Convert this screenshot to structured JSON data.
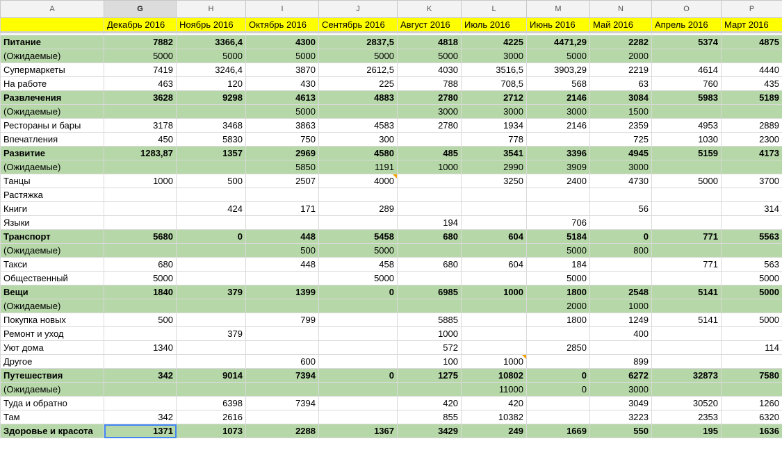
{
  "column_letters": [
    "A",
    "G",
    "H",
    "I",
    "J",
    "K",
    "L",
    "M",
    "N",
    "O",
    "P"
  ],
  "months": [
    "Декабрь 2016",
    "Ноябрь 2016",
    "Октябрь 2016",
    "Сентябрь 2016",
    "Август 2016",
    "Июль 2016",
    "Июнь 2016",
    "Май 2016",
    "Апрель 2016",
    "Март 2016"
  ],
  "colors": {
    "category_fill": "#b6d7a8",
    "header_fill": "#ffff00",
    "selection": "#4285f4",
    "note_marker": "#f4a300"
  },
  "rows": [
    {
      "label": "Питание",
      "type": "category",
      "values": [
        "7882",
        "3366,4",
        "4300",
        "2837,5",
        "4818",
        "4225",
        "4471,29",
        "2282",
        "5374",
        "4875"
      ]
    },
    {
      "label": "(Ожидаемые)",
      "type": "expected",
      "values": [
        "5000",
        "5000",
        "5000",
        "5000",
        "5000",
        "3000",
        "5000",
        "2000",
        "",
        ""
      ]
    },
    {
      "label": "Супермаркеты",
      "type": "item",
      "values": [
        "7419",
        "3246,4",
        "3870",
        "2612,5",
        "4030",
        "3516,5",
        "3903,29",
        "2219",
        "4614",
        "4440"
      ]
    },
    {
      "label": "На работе",
      "type": "item",
      "values": [
        "463",
        "120",
        "430",
        "225",
        "788",
        "708,5",
        "568",
        "63",
        "760",
        "435"
      ]
    },
    {
      "label": "Развлечения",
      "type": "category",
      "values": [
        "3628",
        "9298",
        "4613",
        "4883",
        "2780",
        "2712",
        "2146",
        "3084",
        "5983",
        "5189"
      ]
    },
    {
      "label": "(Ожидаемые)",
      "type": "expected",
      "values": [
        "",
        "",
        "5000",
        "",
        "3000",
        "3000",
        "3000",
        "1500",
        "",
        ""
      ]
    },
    {
      "label": "Рестораны и бары",
      "type": "item",
      "values": [
        "3178",
        "3468",
        "3863",
        "4583",
        "2780",
        "1934",
        "2146",
        "2359",
        "4953",
        "2889"
      ]
    },
    {
      "label": "Впечатления",
      "type": "item",
      "values": [
        "450",
        "5830",
        "750",
        "300",
        "",
        "778",
        "",
        "725",
        "1030",
        "2300"
      ]
    },
    {
      "label": "Развитие",
      "type": "category",
      "values": [
        "1283,87",
        "1357",
        "2969",
        "4580",
        "485",
        "3541",
        "3396",
        "4945",
        "5159",
        "4173"
      ]
    },
    {
      "label": "(Ожидаемые)",
      "type": "expected",
      "values": [
        "",
        "",
        "5850",
        "1191",
        "1000",
        "2990",
        "3909",
        "3000",
        "",
        ""
      ]
    },
    {
      "label": "Танцы",
      "type": "item",
      "values": [
        "1000",
        "500",
        "2507",
        "4000",
        "",
        "3250",
        "2400",
        "4730",
        "5000",
        "3700"
      ]
    },
    {
      "label": "Растяжка",
      "type": "item",
      "values": [
        "",
        "",
        "",
        "",
        "",
        "",
        "",
        "",
        "",
        ""
      ]
    },
    {
      "label": "Книги",
      "type": "item",
      "values": [
        "",
        "424",
        "171",
        "289",
        "",
        "",
        "",
        "56",
        "",
        "314"
      ]
    },
    {
      "label": "Языки",
      "type": "item",
      "values": [
        "",
        "",
        "",
        "",
        "194",
        "",
        "706",
        "",
        "",
        ""
      ]
    },
    {
      "label": "Транспорт",
      "type": "category",
      "values": [
        "5680",
        "0",
        "448",
        "5458",
        "680",
        "604",
        "5184",
        "0",
        "771",
        "5563"
      ]
    },
    {
      "label": "(Ожидаемые)",
      "type": "expected",
      "values": [
        "",
        "",
        "500",
        "5000",
        "",
        "",
        "5000",
        "800",
        "",
        ""
      ]
    },
    {
      "label": "Такси",
      "type": "item",
      "values": [
        "680",
        "",
        "448",
        "458",
        "680",
        "604",
        "184",
        "",
        "771",
        "563"
      ]
    },
    {
      "label": "Общественный",
      "type": "item",
      "values": [
        "5000",
        "",
        "",
        "5000",
        "",
        "",
        "5000",
        "",
        "",
        "5000"
      ]
    },
    {
      "label": "Вещи",
      "type": "category",
      "values": [
        "1840",
        "379",
        "1399",
        "0",
        "6985",
        "1000",
        "1800",
        "2548",
        "5141",
        "5000"
      ]
    },
    {
      "label": "(Ожидаемые)",
      "type": "expected",
      "values": [
        "",
        "",
        "",
        "",
        "",
        "",
        "2000",
        "1000",
        "",
        ""
      ]
    },
    {
      "label": "Покупка новых",
      "type": "item",
      "values": [
        "500",
        "",
        "799",
        "",
        "5885",
        "",
        "1800",
        "1249",
        "5141",
        "5000"
      ]
    },
    {
      "label": "Ремонт и уход",
      "type": "item",
      "values": [
        "",
        "379",
        "",
        "",
        "1000",
        "",
        "",
        "400",
        "",
        ""
      ]
    },
    {
      "label": "Уют дома",
      "type": "item",
      "values": [
        "1340",
        "",
        "",
        "",
        "572",
        "",
        "2850",
        "",
        "",
        "114"
      ]
    },
    {
      "label": "Другое",
      "type": "item",
      "values": [
        "",
        "",
        "600",
        "",
        "100",
        "1000",
        "",
        "899",
        "",
        ""
      ]
    },
    {
      "label": "Путешествия",
      "type": "category",
      "values": [
        "342",
        "9014",
        "7394",
        "0",
        "1275",
        "10802",
        "0",
        "6272",
        "32873",
        "7580"
      ]
    },
    {
      "label": "(Ожидаемые)",
      "type": "expected",
      "values": [
        "",
        "",
        "",
        "",
        "",
        "11000",
        "0",
        "3000",
        "",
        ""
      ]
    },
    {
      "label": "Туда и обратно",
      "type": "item",
      "values": [
        "",
        "6398",
        "7394",
        "",
        "420",
        "420",
        "",
        "3049",
        "30520",
        "1260"
      ]
    },
    {
      "label": "Там",
      "type": "item",
      "values": [
        "342",
        "2616",
        "",
        "",
        "855",
        "10382",
        "",
        "3223",
        "2353",
        "6320"
      ]
    },
    {
      "label": "Здоровье и красота",
      "type": "category",
      "values": [
        "1371",
        "1073",
        "2288",
        "1367",
        "3429",
        "249",
        "1669",
        "550",
        "195",
        "1636"
      ]
    }
  ]
}
